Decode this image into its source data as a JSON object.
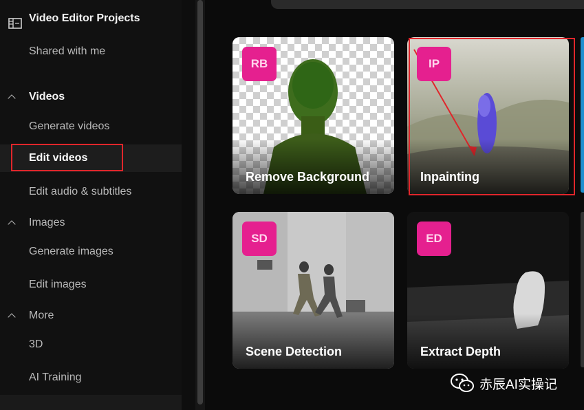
{
  "sidebar": {
    "project_title": "Video Editor Projects",
    "items": [
      {
        "label": "Shared with me"
      },
      {
        "label": "Videos"
      },
      {
        "label": "Generate videos"
      },
      {
        "label": "Edit videos"
      },
      {
        "label": "Edit audio & subtitles"
      },
      {
        "label": "Images"
      },
      {
        "label": "Generate images"
      },
      {
        "label": "Edit images"
      },
      {
        "label": "More"
      },
      {
        "label": "3D"
      },
      {
        "label": "AI Training"
      }
    ]
  },
  "cards": [
    {
      "badge": "RB",
      "label": "Remove Background"
    },
    {
      "badge": "IP",
      "label": "Inpainting"
    },
    {
      "badge": "SD",
      "label": "Scene Detection"
    },
    {
      "badge": "ED",
      "label": "Extract Depth"
    }
  ],
  "watermark": {
    "text": "赤辰AI实操记"
  },
  "colors": {
    "badge": "#e5208f",
    "annotation": "#e0262b"
  }
}
